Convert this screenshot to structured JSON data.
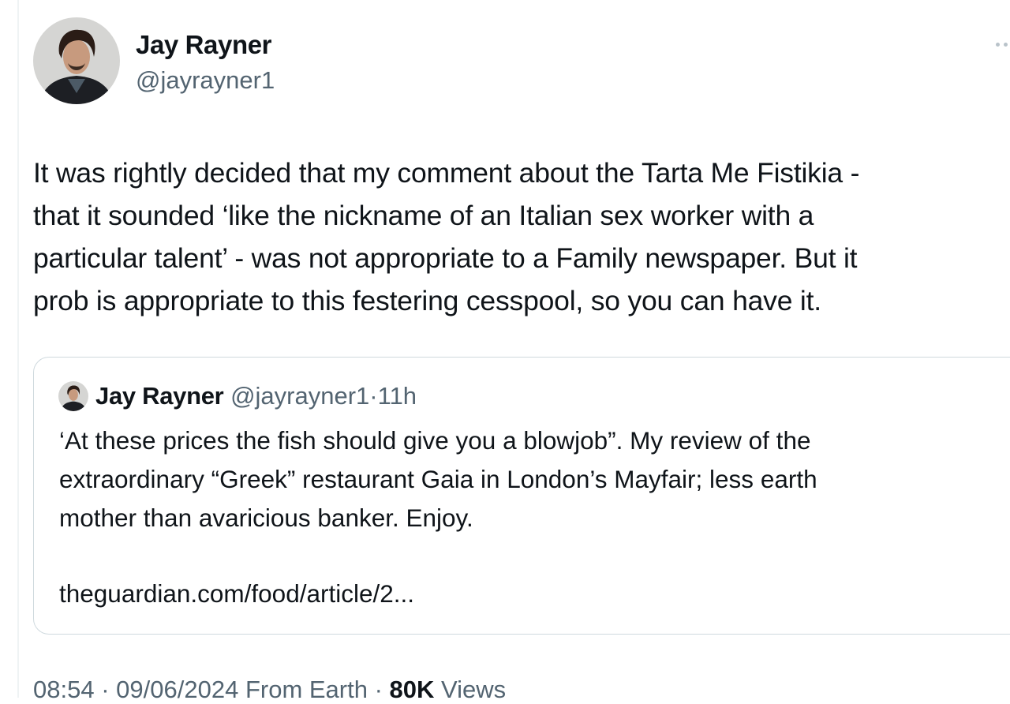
{
  "tweet": {
    "author": {
      "name": "Jay Rayner",
      "handle": "@jayrayner1"
    },
    "text": "It was rightly decided that my comment about the Tarta Me Fistikia -\nthat it sounded ‘like the nickname of an Italian sex worker with a\nparticular talent’ - was not appropriate to a Family newspaper. But it\nprob is appropriate to this festering cesspool, so you can have it.",
    "more_icon": "more-dots-icon"
  },
  "quote": {
    "author": {
      "name": "Jay Rayner",
      "handle": "@jayrayner1",
      "separator": "·",
      "time": "11h"
    },
    "text": "‘At these prices the fish should give you a blowjob”. My review of the\nextraordinary “Greek” restaurant Gaia in London’s Mayfair; less earth\nmother than avaricious banker. Enjoy.",
    "link": "theguardian.com/food/article/2..."
  },
  "meta": {
    "time": "08:54",
    "sep1": "·",
    "date": "09/06/2024",
    "source": "From Earth",
    "sep2": "·",
    "views_count": "80K",
    "views_label": "Views"
  },
  "colors": {
    "text": "#0f1419",
    "secondary": "#536471",
    "border": "#cfd9de"
  }
}
